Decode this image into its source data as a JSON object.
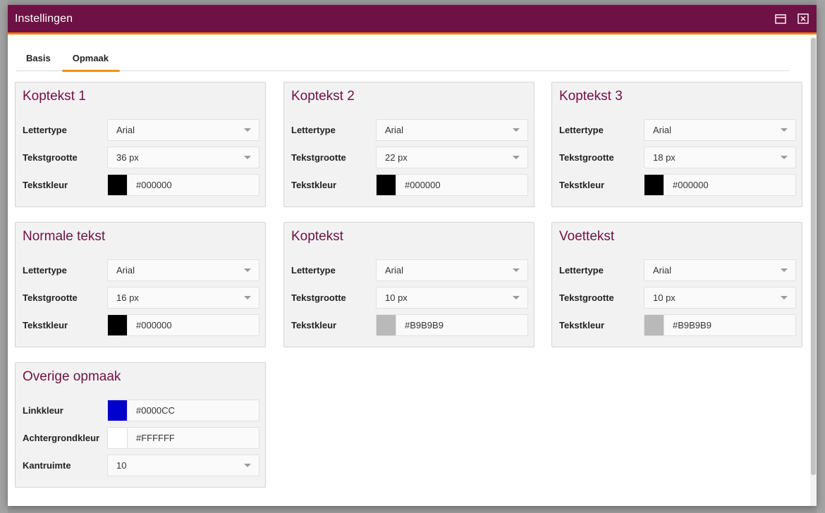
{
  "dialog": {
    "title": "Instellingen"
  },
  "tabs": [
    {
      "label": "Basis",
      "active": false
    },
    {
      "label": "Opmaak",
      "active": true
    }
  ],
  "labels": {
    "lettertype": "Lettertype",
    "tekstgrootte": "Tekstgrootte",
    "tekstkleur": "Tekstkleur",
    "linkkleur": "Linkkleur",
    "achtergrondkleur": "Achtergrondkleur",
    "kantruimte": "Kantruimte"
  },
  "panels": [
    {
      "title": "Koptekst 1",
      "font": "Arial",
      "size": "36 px",
      "color": "#000000"
    },
    {
      "title": "Koptekst 2",
      "font": "Arial",
      "size": "22 px",
      "color": "#000000"
    },
    {
      "title": "Koptekst 3",
      "font": "Arial",
      "size": "18 px",
      "color": "#000000"
    },
    {
      "title": "Normale tekst",
      "font": "Arial",
      "size": "16 px",
      "color": "#000000"
    },
    {
      "title": "Koptekst",
      "font": "Arial",
      "size": "10 px",
      "color": "#B9B9B9"
    },
    {
      "title": "Voettekst",
      "font": "Arial",
      "size": "10 px",
      "color": "#B9B9B9"
    }
  ],
  "overige": {
    "title": "Overige opmaak",
    "link_color": "#0000CC",
    "background_color": "#FFFFFF",
    "kantruimte": "10"
  },
  "colors": {
    "header": "#6e1245",
    "accent": "#f39200"
  }
}
